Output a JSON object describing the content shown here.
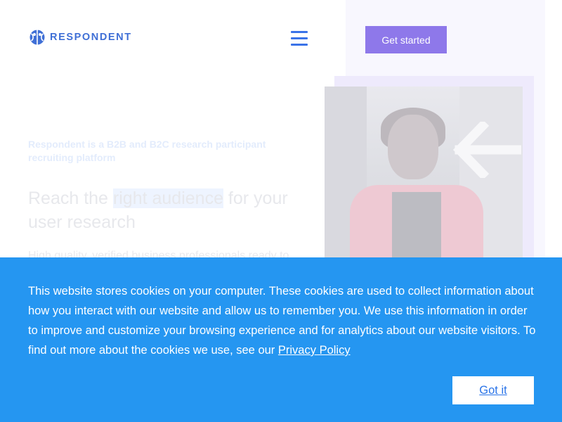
{
  "header": {
    "brand": "RESPONDENT",
    "cta_label": "Get started"
  },
  "hero": {
    "kicker": "Respondent is a B2B and B2C research participant recruiting platform",
    "title_pre": "Reach the ",
    "title_highlight": "right audience",
    "title_post": " for your user research",
    "subtitle": "High quality, verified business professionals ready to"
  },
  "cookie_banner": {
    "message": "This website stores cookies on your computer. These cookies are used to collect information about how you interact with our website and allow us to remember you. We use this information in order to improve and customize your browsing experience and for analytics about our website visitors. To find out more about the cookies we use, see our ",
    "link_label": "Privacy Policy",
    "accept_label": "Got it"
  },
  "colors": {
    "brand_blue": "#3f6fd6",
    "cta_purple": "#8e78ea",
    "banner_blue": "#2596f1"
  },
  "icons": {
    "logo": "respondent-logo-icon",
    "menu": "hamburger-menu-icon",
    "arrow": "arrow-left-icon"
  }
}
